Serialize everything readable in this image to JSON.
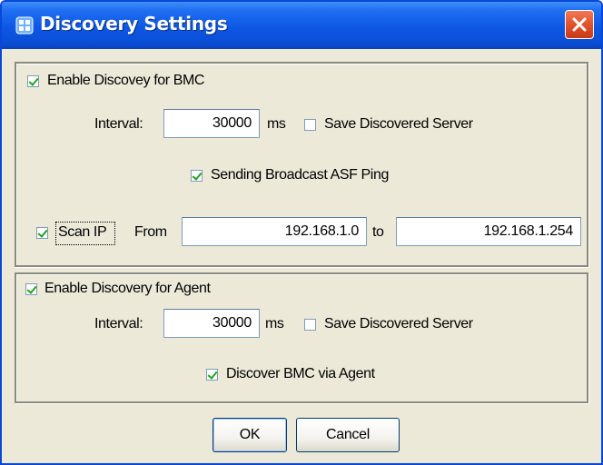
{
  "window": {
    "title": "Discovery Settings",
    "close_label": "×"
  },
  "bmc": {
    "enable_label": "Enable Discovey for BMC",
    "enable_checked": true,
    "interval_label": "Interval:",
    "interval_value": "30000",
    "interval_unit": "ms",
    "save_label": "Save Discovered Server",
    "save_checked": false,
    "broadcast_label": "Sending Broadcast ASF Ping",
    "broadcast_checked": true,
    "scan_label": "Scan IP",
    "scan_checked": true,
    "from_label": "From",
    "from_value": "192.168.1.0",
    "to_label": "to",
    "to_value": "192.168.1.254"
  },
  "agent": {
    "enable_label": "Enable Discovery for Agent",
    "enable_checked": true,
    "interval_label": "Interval:",
    "interval_value": "30000",
    "interval_unit": "ms",
    "save_label": "Save Discovered Server",
    "save_checked": false,
    "via_agent_label": "Discover BMC via Agent",
    "via_agent_checked": true
  },
  "buttons": {
    "ok_label": "OK",
    "cancel_label": "Cancel"
  },
  "colors": {
    "titlebar": "#0a4fd6",
    "dialog_bg": "#ece9d8",
    "close_button": "#e2522c",
    "checkmark": "#21a121"
  }
}
